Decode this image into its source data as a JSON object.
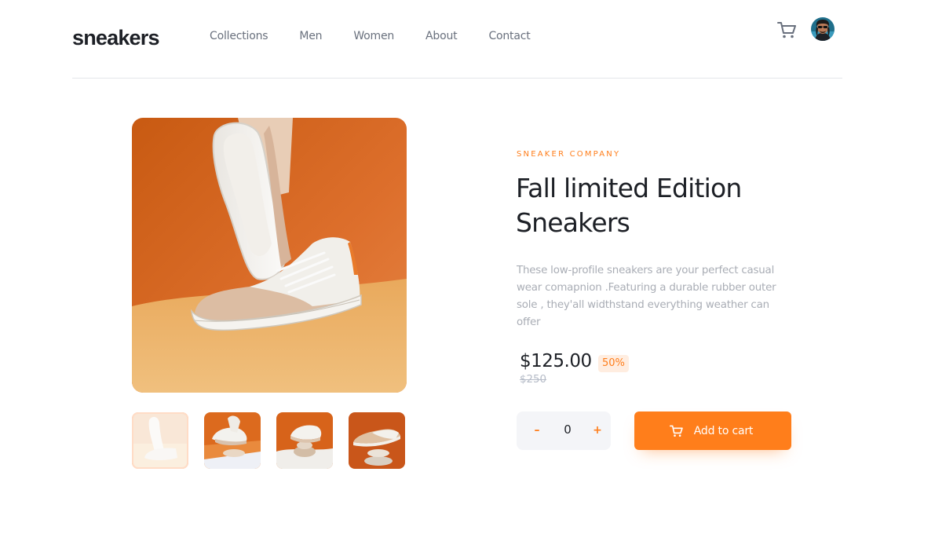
{
  "header": {
    "logo": "sneakers",
    "nav": [
      "Collections",
      "Men",
      "Women",
      "About",
      "Contact"
    ],
    "cart_icon": "cart-icon",
    "avatar_icon": "avatar"
  },
  "product": {
    "company": "SNEAKER COMPANY",
    "title": "Fall limited Edition Sneakers",
    "description": "These low-profile sneakers are your perfect casual wear comapnion .Featuring a durable rubber outer sole , they'all widthstand everything weather can offer",
    "price": "$125.00",
    "discount": "50%",
    "original_price": "$250",
    "quantity": {
      "minus_label": "–",
      "value": "0",
      "plus_label": "+"
    },
    "add_to_cart_label": "Add to cart"
  },
  "gallery": {
    "thumbnails_count_label": "",
    "selected_index": 0
  },
  "colors": {
    "accent": "#ff7e1b",
    "accent_pale": "#ffede0",
    "text_dark": "#1d2026",
    "text_muted": "#69707d",
    "text_light": "#a9adb5"
  }
}
